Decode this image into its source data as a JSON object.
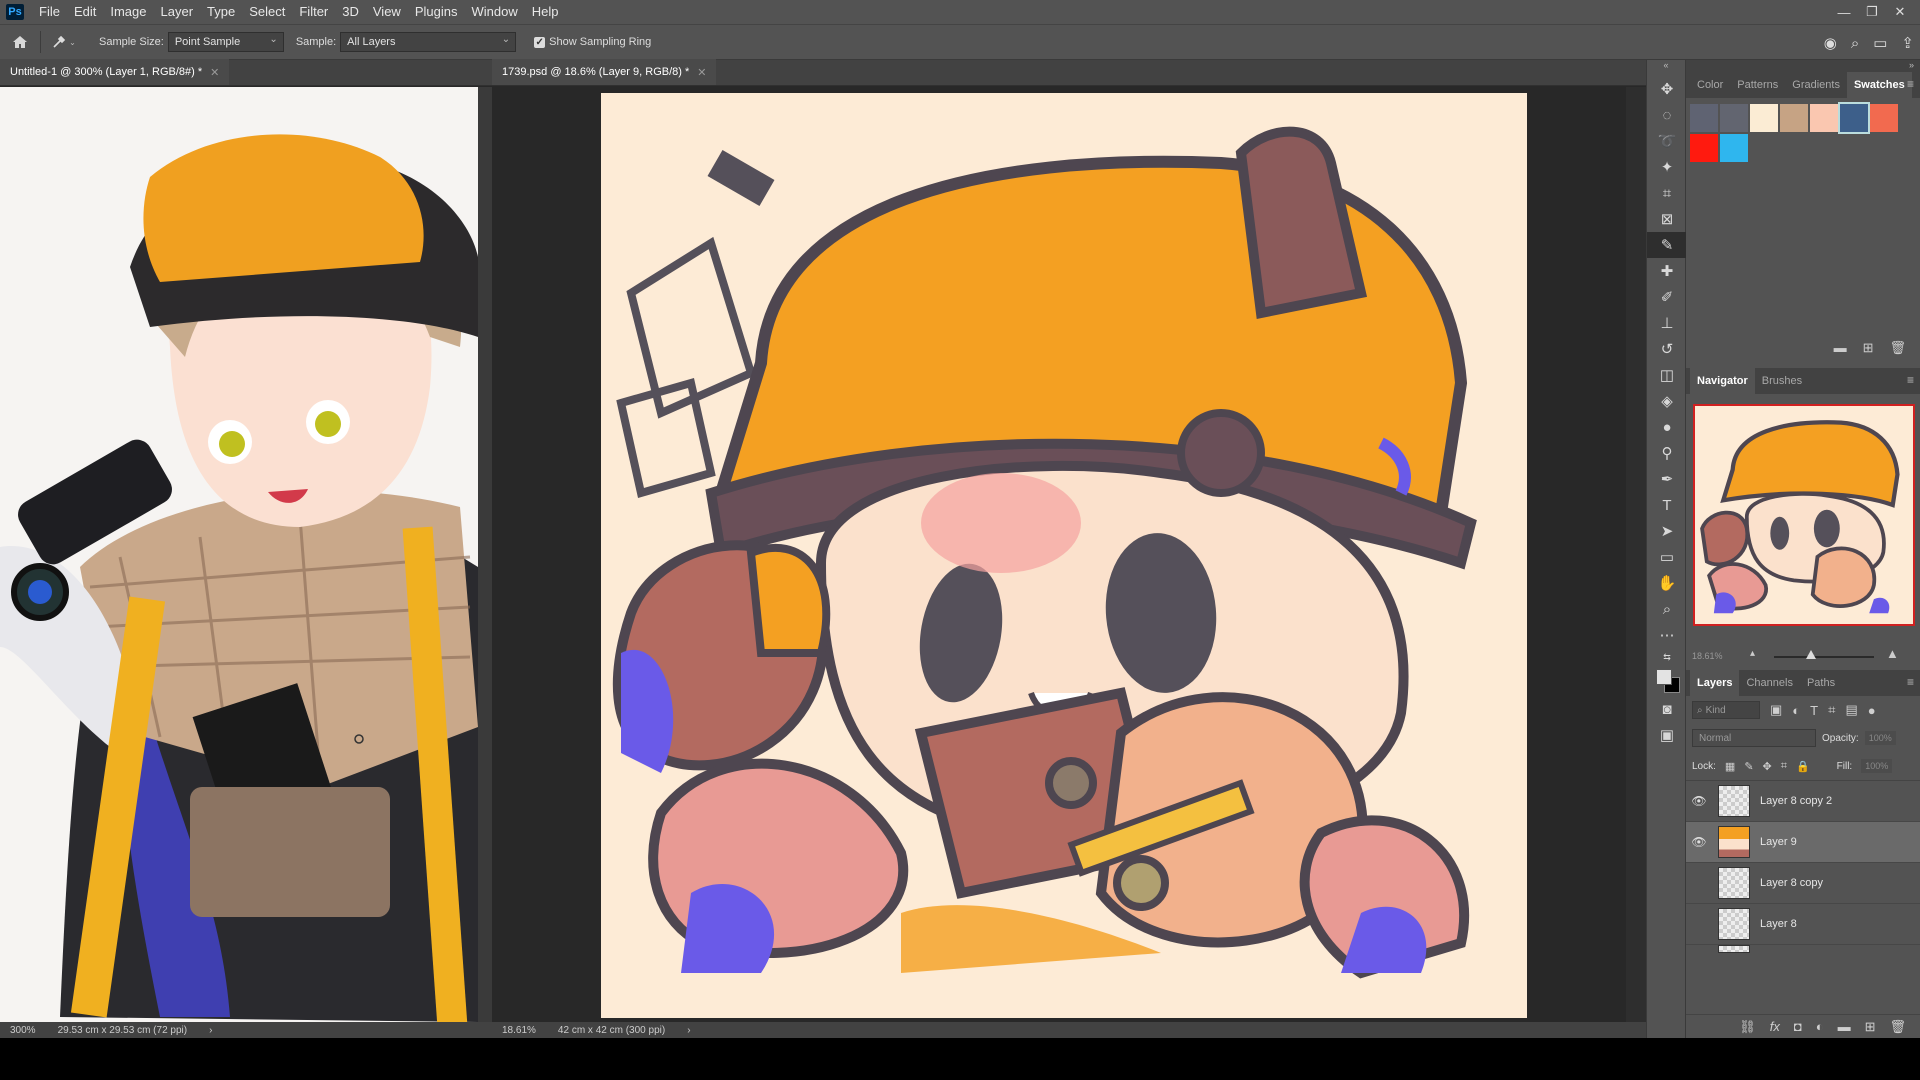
{
  "menubar": {
    "logo": "Ps",
    "items": [
      "File",
      "Edit",
      "Image",
      "Layer",
      "Type",
      "Select",
      "Filter",
      "3D",
      "View",
      "Plugins",
      "Window",
      "Help"
    ],
    "window_controls": [
      "—",
      "❐",
      "✕"
    ]
  },
  "options": {
    "sample_size_label": "Sample Size:",
    "sample_size_value": "Point Sample",
    "sample_label": "Sample:",
    "sample_value": "All Layers",
    "show_ring_label": "Show Sampling Ring",
    "show_ring_checked": true
  },
  "documents": [
    {
      "tab": "Untitled-1 @ 300% (Layer 1, RGB/8#) *",
      "zoom": "300%",
      "size": "29.53 cm x 29.53 cm (72 ppi)"
    },
    {
      "tab": "1739.psd @ 18.6% (Layer 9, RGB/8) *",
      "zoom": "18.61%",
      "size": "42 cm x 42 cm (300 ppi)"
    }
  ],
  "swatches_panel": {
    "tabs": [
      "Color",
      "Patterns",
      "Gradients",
      "Swatches"
    ],
    "active": "Swatches",
    "colors": [
      "#5f6372",
      "#626570",
      "#fbecd4",
      "#c6a384",
      "#fac7b0",
      "#3d5f8a",
      "#f26a4f",
      "#ff1a0f",
      "#2fb6ee"
    ]
  },
  "navigator_panel": {
    "tabs": [
      "Navigator",
      "Brushes"
    ],
    "active": "Navigator",
    "zoom": "18.61%"
  },
  "layers_panel": {
    "tabs": [
      "Layers",
      "Channels",
      "Paths"
    ],
    "active": "Layers",
    "search_placeholder": "Kind",
    "blend_mode": "Normal",
    "opacity_label": "Opacity:",
    "opacity_value": "100%",
    "lock_label": "Lock:",
    "fill_label": "Fill:",
    "fill_value": "100%",
    "layers": [
      {
        "name": "Layer 8 copy 2",
        "visible": true,
        "selected": false
      },
      {
        "name": "Layer 9",
        "visible": true,
        "selected": true
      },
      {
        "name": "Layer 8 copy",
        "visible": false,
        "selected": false
      },
      {
        "name": "Layer 8",
        "visible": false,
        "selected": false
      }
    ]
  }
}
